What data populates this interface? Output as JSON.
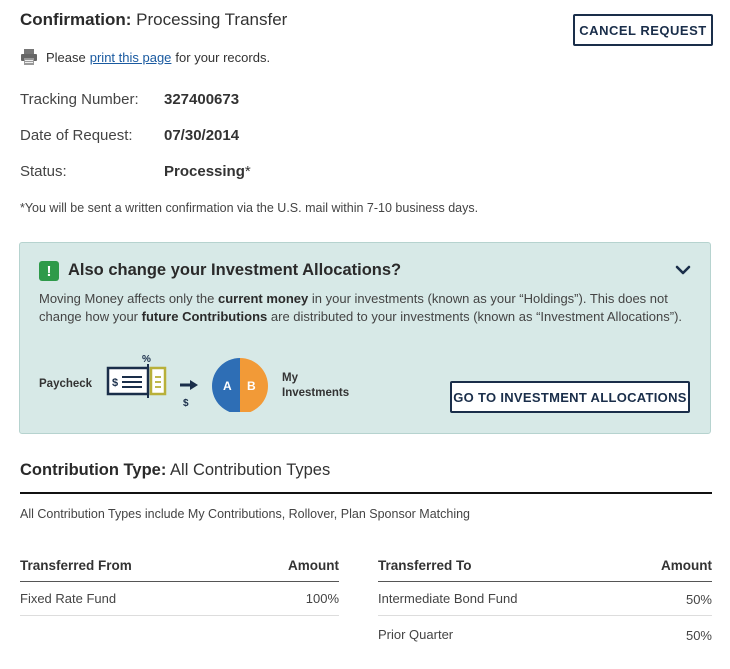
{
  "header": {
    "title_bold": "Confirmation:",
    "title_rest": "Processing Transfer",
    "cancel_label": "CANCEL REQUEST"
  },
  "print": {
    "icon": "printer-icon",
    "before": "Please",
    "link": "print this page",
    "after": "for your records."
  },
  "details": [
    {
      "label": "Tracking Number:",
      "value": "327400673"
    },
    {
      "label": "Date of Request:",
      "value": "07/30/2014"
    },
    {
      "label": "Status:",
      "value": "Processing",
      "suffix": "*"
    }
  ],
  "note": "*You will be sent a written confirmation via the U.S. mail within 7-10 business days.",
  "alert": {
    "icon": "exclamation-icon",
    "title": "Also change your Investment Allocations?",
    "body_1": "Moving Money affects only the ",
    "body_bold_1": "current money",
    "body_2": " in your investments (known as your “Holdings”). This does not change how your ",
    "body_bold_2": "future Contributions",
    "body_3": " are distributed to your investments (known as “Investment Allocations”).",
    "paycheck_label": "Paycheck",
    "percent_symbol": "%",
    "dollar_symbol": "$",
    "cheque_symbol": "$",
    "pie_a": "A",
    "pie_b": "B",
    "investments_label_1": "My",
    "investments_label_2": "Investments",
    "button_label": "GO TO INVESTMENT ALLOCATIONS",
    "colors": {
      "background": "#d7e9e7",
      "icon": "#2e9a4a",
      "pie_a": "#2e6eb5",
      "pie_b": "#f29a37",
      "cheque_slip": "#b8b03a",
      "navy": "#1a2e4a"
    }
  },
  "contribution": {
    "title_bold": "Contribution Type:",
    "title_rest": "All Contribution Types",
    "note": "All Contribution Types include My Contributions, Rollover, Plan Sponsor Matching"
  },
  "from_table": {
    "col_1": "Transferred From",
    "col_2": "Amount",
    "rows": [
      {
        "name": "Fixed Rate Fund",
        "amount": "100%"
      }
    ]
  },
  "to_table": {
    "col_1": "Transferred To",
    "col_2": "Amount",
    "rows": [
      {
        "name": "Intermediate Bond Fund",
        "amount": "50%"
      },
      {
        "name": "Prior Quarter",
        "amount": "50%"
      }
    ]
  }
}
